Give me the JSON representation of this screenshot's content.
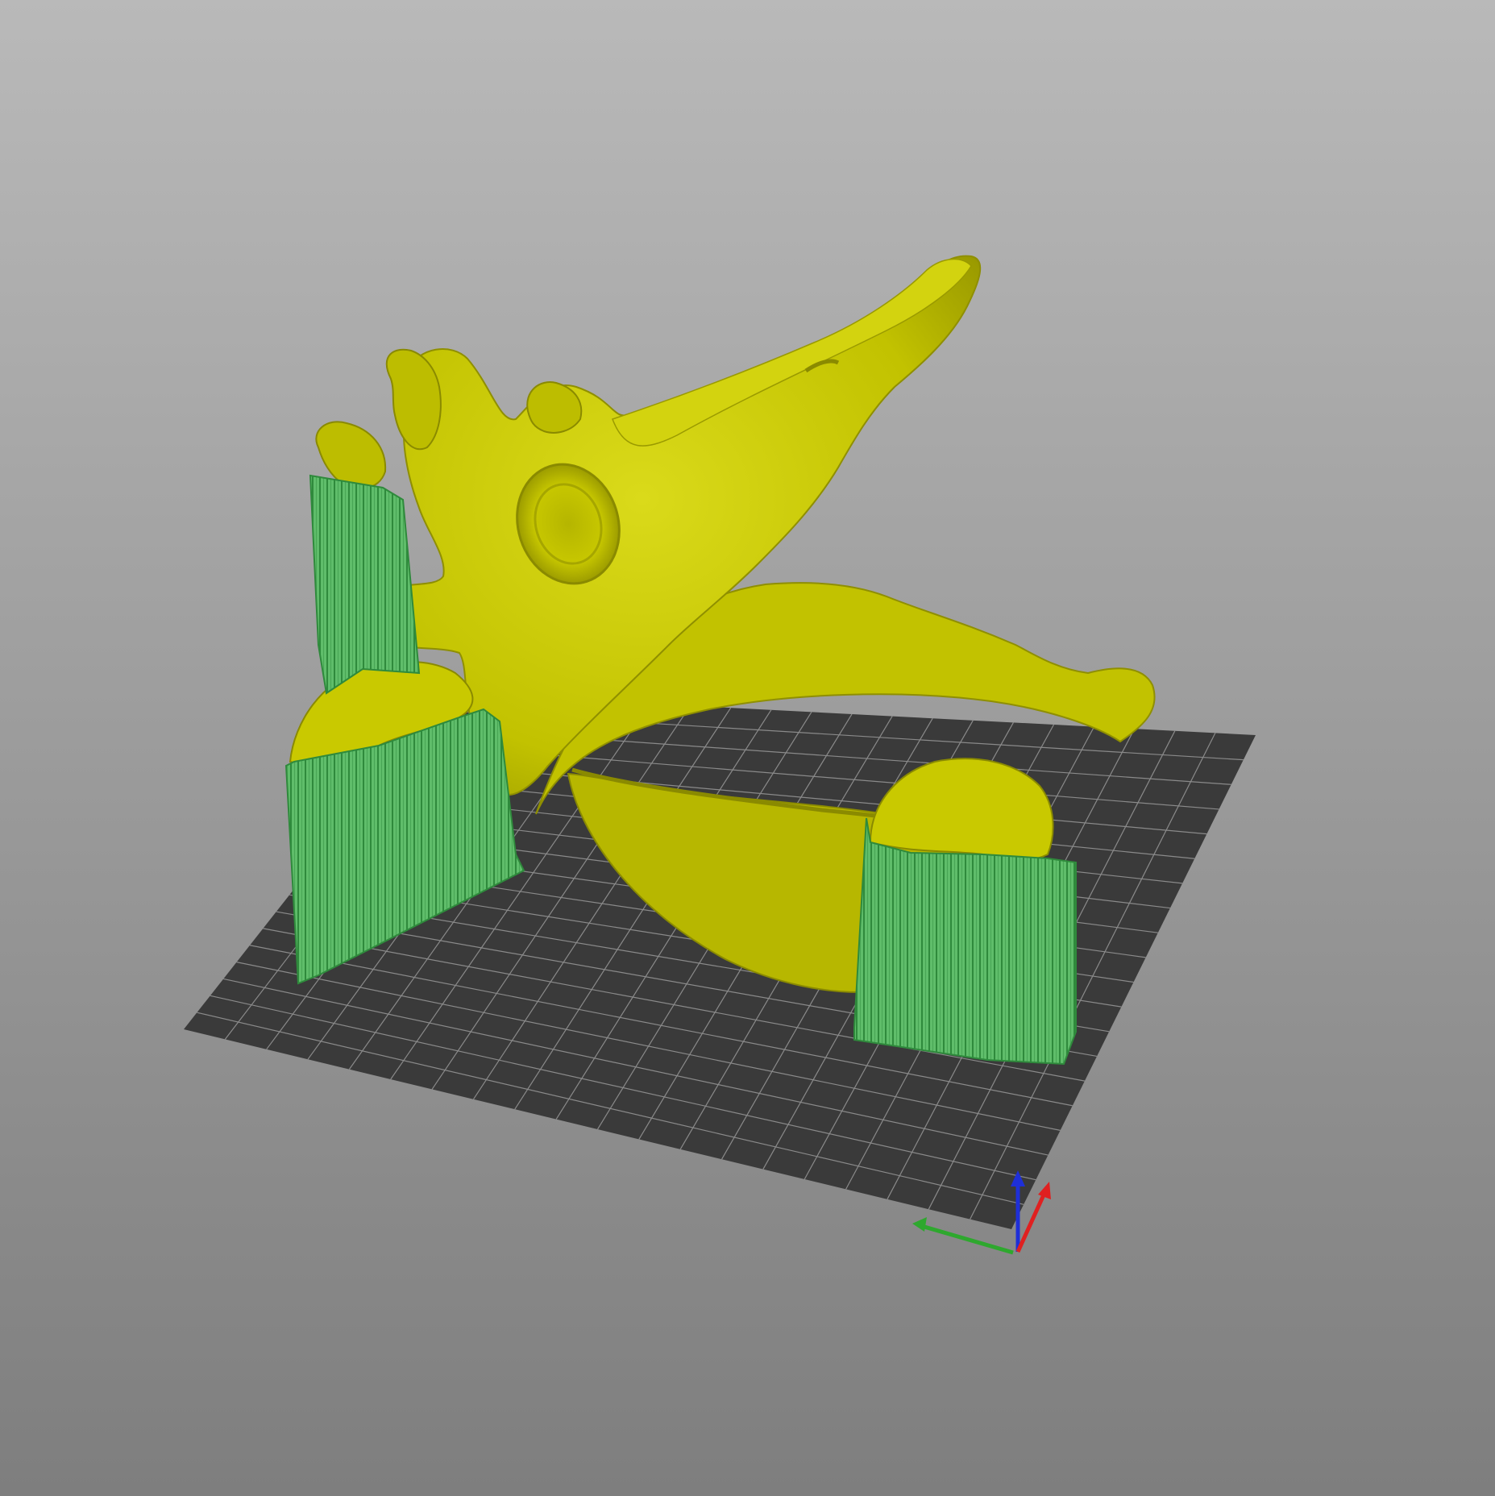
{
  "viewport": {
    "view": "3d-preview",
    "background_top_color": "#b9b9b9",
    "background_bottom_color": "#7e7e7e"
  },
  "build_plate": {
    "color": "#3a3a3a",
    "grid_line_color": "#8a8a8a",
    "grid_divisions": 20
  },
  "model": {
    "kind": "skull",
    "color": "#c7c700",
    "highlight_color": "#e4e13a",
    "shade_color": "#8f8f00"
  },
  "supports": {
    "color": "#5fbd6a",
    "stripe_color": "#2f8a3c",
    "count": 3
  },
  "axes": {
    "x_color": "#2ea82e",
    "y_color": "#e02020",
    "z_color": "#1e2fd8"
  }
}
